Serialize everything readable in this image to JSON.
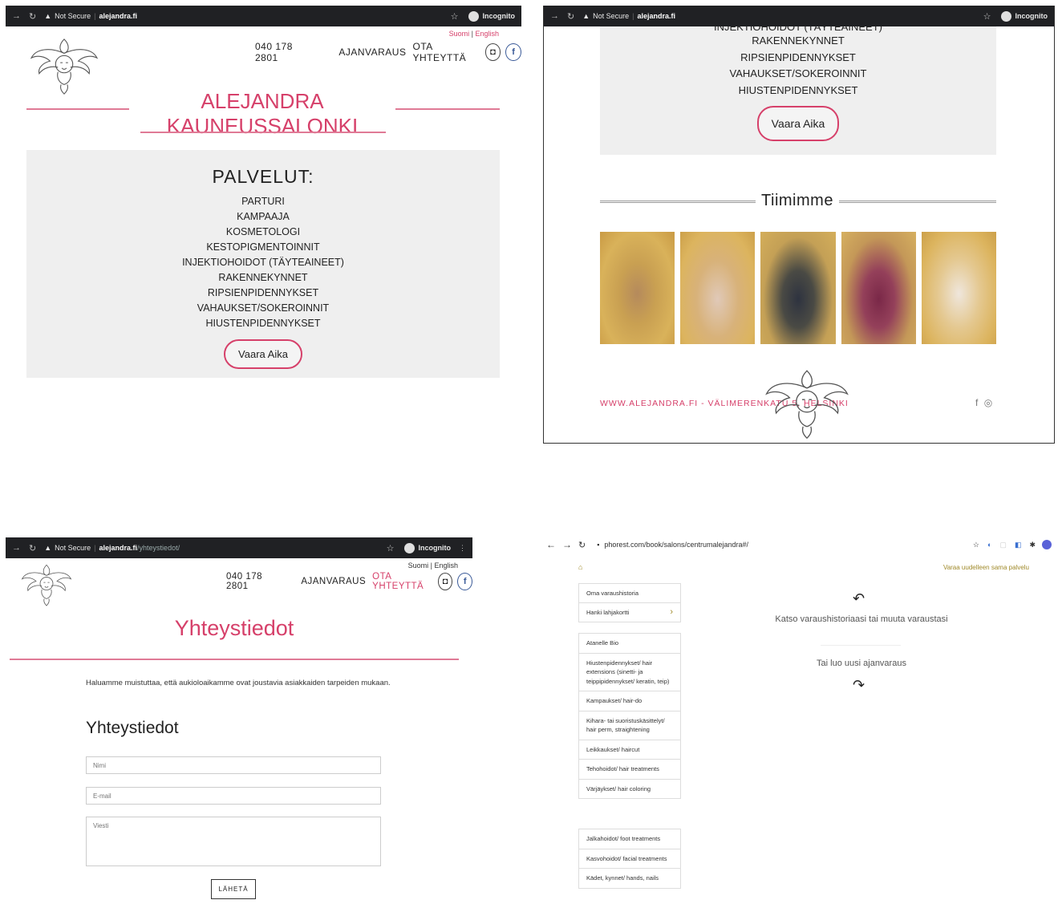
{
  "panel1": {
    "browser": {
      "security": "Not Secure",
      "host": "alejandra.fi",
      "incognito": "Incognito"
    },
    "lang": {
      "suomi": "Suomi",
      "sep": "|",
      "english": "English"
    },
    "phone": "040 178 2801",
    "nav": {
      "booking": "AJANVARAUS",
      "contact": "OTA YHTEYTTÄ"
    },
    "title": "ALEJANDRA KAUNEUSSALONKI",
    "services_heading": "PALVELUT:",
    "services": [
      "PARTURI",
      "KAMPAAJA",
      "KOSMETOLOGI",
      "KESTOPIGMENTOINNIT",
      "INJEKTIOHOIDOT (TÄYTEAINEET)",
      "RAKENNEKYNNET",
      "RIPSIENPIDENNYKSET",
      "VAHAUKSET/SOKEROINNIT",
      "HIUSTENPIDENNYKSET"
    ],
    "book_button": "Vaara Aika"
  },
  "panel2": {
    "browser": {
      "security": "Not Secure",
      "host": "alejandra.fi",
      "incognito": "Incognito"
    },
    "cut_line": "INJEKTIOHOIDOT (TÄYTEAINEET)",
    "services": [
      "RAKENNEKYNNET",
      "RIPSIENPIDENNYKSET",
      "VAHAUKSET/SOKEROINNIT",
      "HIUSTENPIDENNYKSET"
    ],
    "book_button": "Vaara Aika",
    "team_heading": "Tiimimme",
    "footer_text": "WWW.ALEJANDRA.FI - VÄLIMERENKATU 5, HELSINKI"
  },
  "panel3": {
    "browser": {
      "security": "Not Secure",
      "host": "alejandra.fi",
      "path": "/yhteystiedot/",
      "incognito": "Incognito"
    },
    "lang": {
      "suomi": "Suomi",
      "sep": "|",
      "english": "English"
    },
    "phone": "040 178 2801",
    "nav": {
      "booking": "AJANVARAUS",
      "contact": "OTA YHTEYTTÄ"
    },
    "title": "Yhteystiedot",
    "notice": "Haluamme muistuttaa, että aukioloaikamme ovat joustavia asiakkaiden tarpeiden mukaan.",
    "form_heading": "Yhteystiedot",
    "form": {
      "name_placeholder": "Nimi",
      "email_placeholder": "E-mail",
      "message_placeholder": "Viesti",
      "submit": "LÄHETÄ"
    }
  },
  "panel4": {
    "browser": {
      "url": "phorest.com/book/salons/centrumalejandra#/"
    },
    "rebook_link": "Varaa uudelleen sama palvelu",
    "account_items": [
      "Oma varaushistoria",
      "Hanki lahjakortti"
    ],
    "category_group1": [
      "Atanelle Bio",
      "Hiustenpidennykset/ hair extensions (sinetti- ja teippipidennykset/ keratin, teip)",
      "Kampaukset/ hair-do",
      "Kihara- tai suoristuskäsittelyt/ hair perm, straightening",
      "Leikkaukset/ haircut",
      "Tehohoidot/ hair treatments",
      "Värjäykset/ hair coloring"
    ],
    "category_group2": [
      "Jalkahoidot/ foot treatments",
      "Kasvohoidot/ facial treatments",
      "Kädet, kynnet/ hands, nails"
    ],
    "history_text": "Katso varaushistoriaasi tai muuta varaustasi",
    "new_booking_text": "Tai luo uusi ajanvaraus"
  },
  "colors": {
    "accent": "#d6406a",
    "chrome": "#202124",
    "services_bg": "#efefef",
    "rebook": "#a08a2a"
  },
  "icons": [
    "back-arrow-icon",
    "forward-arrow-icon",
    "reload-icon",
    "warning-icon",
    "star-icon",
    "incognito-icon",
    "instagram-icon",
    "facebook-icon",
    "home-icon",
    "chevron-right-icon",
    "reply-arrow-icon",
    "redo-arrow-icon",
    "lock-icon",
    "menu-dots-icon"
  ]
}
